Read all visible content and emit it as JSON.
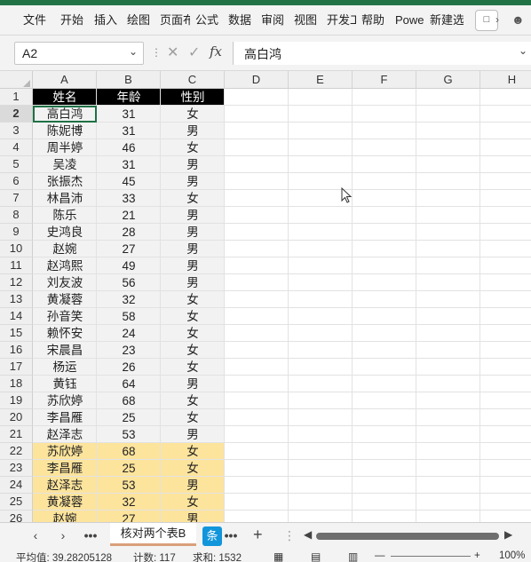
{
  "ribbon": {
    "tabs": [
      "文件",
      "开始",
      "插入",
      "绘图",
      "页面布局",
      "公式",
      "数据",
      "审阅",
      "视图",
      "开发工具",
      "帮助",
      "Power Pivot",
      "新建选项卡"
    ]
  },
  "formula_bar": {
    "name_box": "A2",
    "formula": "高白鸿",
    "fx": "fx"
  },
  "columns": [
    "A",
    "B",
    "C",
    "D",
    "E",
    "F",
    "G",
    "H"
  ],
  "rows": [
    {
      "n": "1",
      "a": "姓名",
      "b": "年龄",
      "c": "性别",
      "style": "header"
    },
    {
      "n": "2",
      "a": "高白鸿",
      "b": "31",
      "c": "女",
      "style": "plain"
    },
    {
      "n": "3",
      "a": "陈妮博",
      "b": "31",
      "c": "男",
      "style": "plain"
    },
    {
      "n": "4",
      "a": "周半婷",
      "b": "46",
      "c": "女",
      "style": "plain"
    },
    {
      "n": "5",
      "a": "吴凌",
      "b": "31",
      "c": "男",
      "style": "plain"
    },
    {
      "n": "6",
      "a": "张振杰",
      "b": "45",
      "c": "男",
      "style": "plain"
    },
    {
      "n": "7",
      "a": "林昌沛",
      "b": "33",
      "c": "女",
      "style": "plain"
    },
    {
      "n": "8",
      "a": "陈乐",
      "b": "21",
      "c": "男",
      "style": "plain"
    },
    {
      "n": "9",
      "a": "史鸿良",
      "b": "28",
      "c": "男",
      "style": "plain"
    },
    {
      "n": "10",
      "a": "赵婉",
      "b": "27",
      "c": "男",
      "style": "plain"
    },
    {
      "n": "11",
      "a": "赵鸿熙",
      "b": "49",
      "c": "男",
      "style": "plain"
    },
    {
      "n": "12",
      "a": "刘友波",
      "b": "56",
      "c": "男",
      "style": "plain"
    },
    {
      "n": "13",
      "a": "黄凝蓉",
      "b": "32",
      "c": "女",
      "style": "plain"
    },
    {
      "n": "14",
      "a": "孙音笑",
      "b": "58",
      "c": "女",
      "style": "plain"
    },
    {
      "n": "15",
      "a": "赖怀安",
      "b": "24",
      "c": "女",
      "style": "plain"
    },
    {
      "n": "16",
      "a": "宋晨昌",
      "b": "23",
      "c": "女",
      "style": "plain"
    },
    {
      "n": "17",
      "a": "杨运",
      "b": "26",
      "c": "女",
      "style": "plain"
    },
    {
      "n": "18",
      "a": "黄钰",
      "b": "64",
      "c": "男",
      "style": "plain"
    },
    {
      "n": "19",
      "a": "苏欣婷",
      "b": "68",
      "c": "女",
      "style": "plain"
    },
    {
      "n": "20",
      "a": "李昌雁",
      "b": "25",
      "c": "女",
      "style": "plain"
    },
    {
      "n": "21",
      "a": "赵泽志",
      "b": "53",
      "c": "男",
      "style": "plain"
    },
    {
      "n": "22",
      "a": "苏欣婷",
      "b": "68",
      "c": "女",
      "style": "hl"
    },
    {
      "n": "23",
      "a": "李昌雁",
      "b": "25",
      "c": "女",
      "style": "hl"
    },
    {
      "n": "24",
      "a": "赵泽志",
      "b": "53",
      "c": "男",
      "style": "hl"
    },
    {
      "n": "25",
      "a": "黄凝蓉",
      "b": "32",
      "c": "女",
      "style": "hl"
    },
    {
      "n": "26",
      "a": "赵婉",
      "b": "27",
      "c": "男",
      "style": "hl"
    }
  ],
  "sheets": {
    "active": "核对两个表B",
    "second": "条"
  },
  "status": {
    "average": "平均值: 39.28205128",
    "count": "计数: 117",
    "sum": "求和: 1532",
    "zoom": "100%"
  }
}
